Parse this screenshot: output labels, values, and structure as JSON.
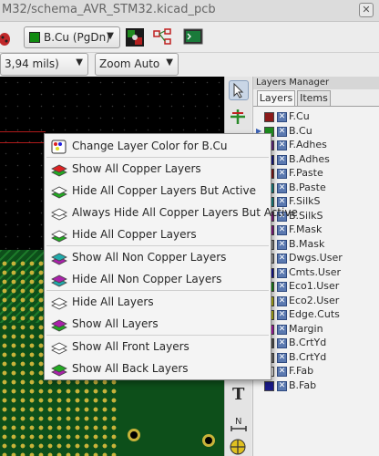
{
  "window": {
    "title": "M32/schema_AVR_STM32.kicad_pcb",
    "close_glyph": "✕"
  },
  "toolbar": {
    "layer_select": {
      "value": "B.Cu (PgDn)",
      "swatch": "#0f8a0f"
    },
    "grid_select": {
      "value": "3,94 mils)"
    },
    "zoom_select": {
      "value": "Zoom Auto"
    }
  },
  "layers_manager": {
    "title": "Layers Manager",
    "tabs": [
      "Layers",
      "Items"
    ],
    "layers": [
      {
        "name": "F.Cu",
        "color": "#8b1a1a"
      },
      {
        "name": "B.Cu",
        "color": "#1d8a1d",
        "current": true
      },
      {
        "name": "F.Adhes",
        "color": "#6a2a8a"
      },
      {
        "name": "B.Adhes",
        "color": "#1a1a8a"
      },
      {
        "name": "F.Paste",
        "color": "#8a1a1a"
      },
      {
        "name": "B.Paste",
        "color": "#1a8a8a"
      },
      {
        "name": "F.SilkS",
        "color": "#1a8a8a"
      },
      {
        "name": "B.SilkS",
        "color": "#8a1a8a"
      },
      {
        "name": "F.Mask",
        "color": "#8a1a8a"
      },
      {
        "name": "B.Mask",
        "color": "#8a8a8a"
      },
      {
        "name": "Dwgs.User",
        "color": "#9a9a9a"
      },
      {
        "name": "Cmts.User",
        "color": "#1a1a9a"
      },
      {
        "name": "Eco1.User",
        "color": "#1a8a1a"
      },
      {
        "name": "Eco2.User",
        "color": "#b5b51a"
      },
      {
        "name": "Edge.Cuts",
        "color": "#b5b51a"
      },
      {
        "name": "Margin",
        "color": "#b51ab5"
      },
      {
        "name": "B.CrtYd",
        "color": "#555555"
      },
      {
        "name": "B.CrtYd",
        "color": "#6a6a6a"
      },
      {
        "name": "F.Fab",
        "color": "#e0e0e0"
      },
      {
        "name": "B.Fab",
        "color": "#1a1a8a"
      }
    ]
  },
  "context_menu": {
    "items": [
      {
        "label": "Change Layer Color for B.Cu",
        "icon": "palette-icon"
      },
      {
        "label": "Show All Copper Layers",
        "icon": "show-copper-icon"
      },
      {
        "label": "Hide All Copper Layers But Active",
        "icon": "hide-copper-but-active-icon"
      },
      {
        "label": "Always Hide All Copper Layers But Active",
        "icon": "always-hide-copper-icon"
      },
      {
        "label": "Hide All Copper Layers",
        "icon": "hide-copper-icon"
      },
      {
        "label": "Show All Non Copper Layers",
        "icon": "show-non-copper-icon"
      },
      {
        "label": "Hide All Non Copper Layers",
        "icon": "hide-non-copper-icon"
      },
      {
        "label": "Hide All Layers",
        "icon": "hide-all-layers-icon"
      },
      {
        "label": "Show All Layers",
        "icon": "show-all-layers-icon"
      },
      {
        "label": "Show All Front Layers",
        "icon": "show-front-layers-icon"
      },
      {
        "label": "Show All Back Layers",
        "icon": "show-back-layers-icon"
      }
    ]
  },
  "right_toolbar": {
    "text_tool_glyph": "T",
    "dimension_tool_glyph": "N"
  }
}
